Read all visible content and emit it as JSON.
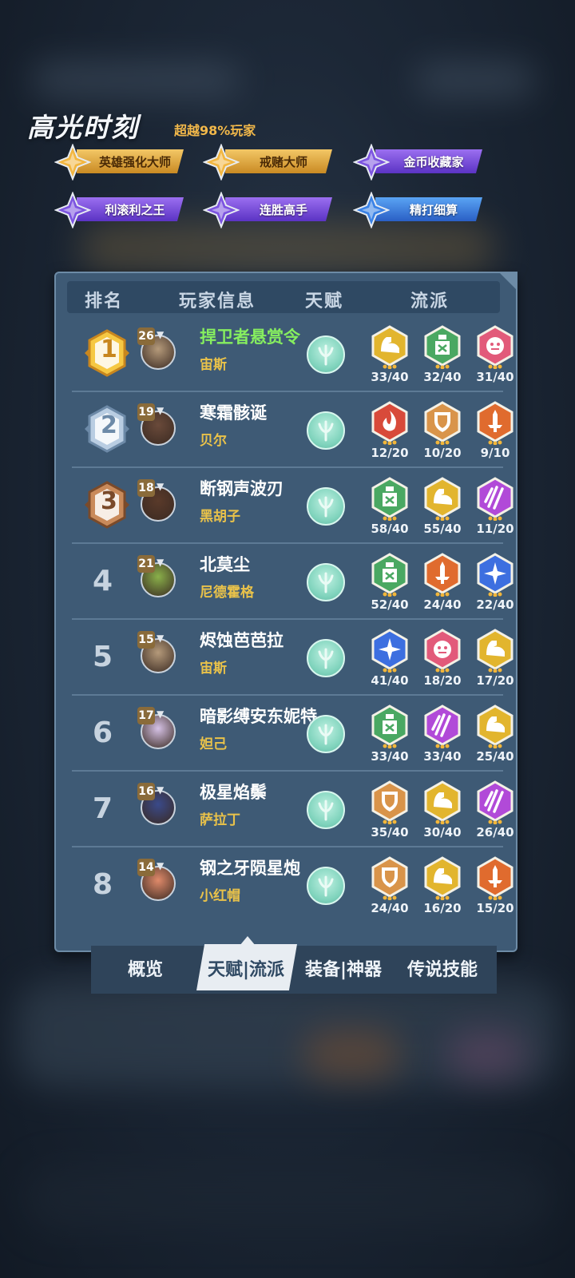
{
  "highlights": {
    "title": "高光时刻",
    "subtitle": "超越98%玩家",
    "badges": [
      {
        "label": "英雄强化大师",
        "tier": "gold"
      },
      {
        "label": "戒赌大师",
        "tier": "gold"
      },
      {
        "label": "金币收藏家",
        "tier": "purple"
      },
      {
        "label": "利滚利之王",
        "tier": "purple"
      },
      {
        "label": "连胜高手",
        "tier": "purple"
      },
      {
        "label": "精打细算",
        "tier": "blue"
      }
    ]
  },
  "table": {
    "headers": {
      "rank": "排名",
      "player": "玩家信息",
      "talent": "天赋",
      "style": "流派"
    },
    "rows": [
      {
        "rank": "1",
        "level": "26",
        "name": "捍卫者悬赏令",
        "hero": "宙斯",
        "styles": [
          {
            "icon": "muscle-icon",
            "color": "yellow",
            "count": "33/40"
          },
          {
            "icon": "potion-icon",
            "color": "green",
            "count": "32/40"
          },
          {
            "icon": "face-icon",
            "color": "pink",
            "count": "31/40"
          }
        ]
      },
      {
        "rank": "2",
        "level": "19",
        "name": "寒霜骸诞",
        "hero": "贝尔",
        "styles": [
          {
            "icon": "flame-icon",
            "color": "red",
            "count": "12/20"
          },
          {
            "icon": "shield-icon",
            "color": "tan",
            "count": "10/20"
          },
          {
            "icon": "sword-icon",
            "color": "orange",
            "count": "9/10"
          }
        ]
      },
      {
        "rank": "3",
        "level": "18",
        "name": "断钢声波刃",
        "hero": "黑胡子",
        "styles": [
          {
            "icon": "potion-icon",
            "color": "green",
            "count": "58/40"
          },
          {
            "icon": "muscle-icon",
            "color": "yellow",
            "count": "55/40"
          },
          {
            "icon": "claw-icon",
            "color": "purple",
            "count": "11/20"
          }
        ]
      },
      {
        "rank": "4",
        "level": "21",
        "name": "北莫尘",
        "hero": "尼德霍格",
        "styles": [
          {
            "icon": "potion-icon",
            "color": "green",
            "count": "52/40"
          },
          {
            "icon": "sword-icon",
            "color": "orange",
            "count": "24/40"
          },
          {
            "icon": "star-icon",
            "color": "blue",
            "count": "22/40"
          }
        ]
      },
      {
        "rank": "5",
        "level": "15",
        "name": "烬蚀芭芭拉",
        "hero": "宙斯",
        "styles": [
          {
            "icon": "star-icon",
            "color": "blue",
            "count": "41/40"
          },
          {
            "icon": "face-icon",
            "color": "pink",
            "count": "18/20"
          },
          {
            "icon": "muscle-icon",
            "color": "yellow",
            "count": "17/20"
          }
        ]
      },
      {
        "rank": "6",
        "level": "17",
        "name": "暗影缚安东妮特",
        "hero": "妲己",
        "styles": [
          {
            "icon": "potion-icon",
            "color": "green",
            "count": "33/40"
          },
          {
            "icon": "claw-icon",
            "color": "purple",
            "count": "33/40"
          },
          {
            "icon": "muscle-icon",
            "color": "yellow",
            "count": "25/40"
          }
        ]
      },
      {
        "rank": "7",
        "level": "16",
        "name": "极星焰鬃",
        "hero": "萨拉丁",
        "styles": [
          {
            "icon": "shield-icon",
            "color": "tan",
            "count": "35/40"
          },
          {
            "icon": "muscle-icon",
            "color": "yellow",
            "count": "30/40"
          },
          {
            "icon": "claw-icon",
            "color": "purple",
            "count": "26/40"
          }
        ]
      },
      {
        "rank": "8",
        "level": "14",
        "name": "钢之牙陨星炮",
        "hero": "小红帽",
        "styles": [
          {
            "icon": "shield-icon",
            "color": "tan",
            "count": "24/40"
          },
          {
            "icon": "muscle-icon",
            "color": "yellow",
            "count": "16/20"
          },
          {
            "icon": "sword-icon",
            "color": "orange",
            "count": "15/20"
          }
        ]
      }
    ]
  },
  "tabs": {
    "overview": "概览",
    "talent_style": "天赋|流派",
    "gear": "装备|神器",
    "legend": "传说技能"
  },
  "colors": {
    "yellow": "#e2b52e",
    "green": "#4aa862",
    "pink": "#e25a7a",
    "red": "#d84a3a",
    "tan": "#d9944a",
    "orange": "#e06b2e",
    "purple": "#b14ad8",
    "blue": "#3d6fe0"
  }
}
